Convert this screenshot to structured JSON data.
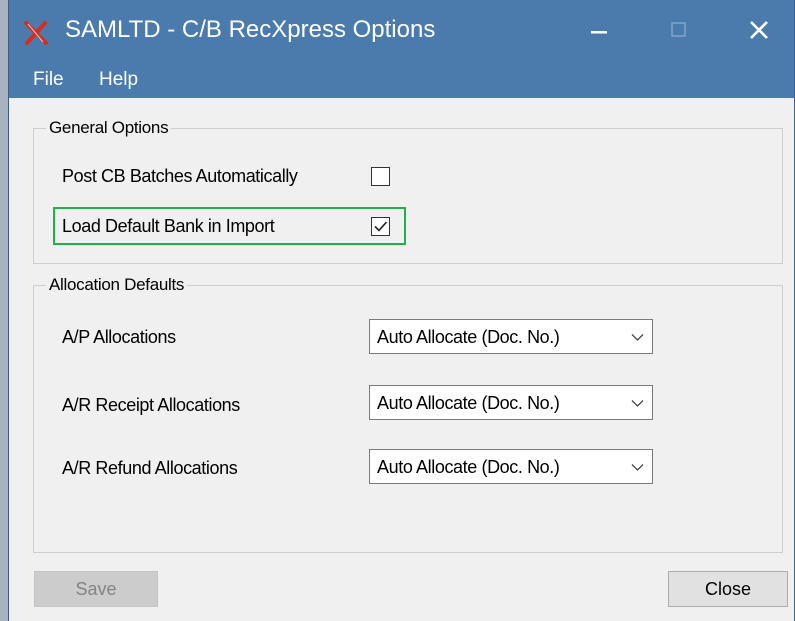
{
  "window": {
    "title": "SAMLTD - C/B RecXpress Options",
    "icon": "red-x-app-icon",
    "controls": [
      "minimize-icon",
      "maximize-icon",
      "close-icon"
    ]
  },
  "menu": {
    "file": "File",
    "help": "Help"
  },
  "general": {
    "legend": "General Options",
    "post_batches": {
      "label": "Post CB Batches Automatically",
      "checked": false
    },
    "load_bank": {
      "label": "Load Default Bank in Import",
      "checked": true
    }
  },
  "allocation": {
    "legend": "Allocation Defaults",
    "rows": [
      {
        "label": "A/P Allocations",
        "value": "Auto Allocate (Doc. No.)"
      },
      {
        "label": "A/R Receipt Allocations",
        "value": "Auto Allocate (Doc. No.)"
      },
      {
        "label": "A/R Refund Allocations",
        "value": "Auto Allocate (Doc. No.)"
      }
    ]
  },
  "buttons": {
    "save": "Save",
    "save_enabled": false,
    "close": "Close"
  },
  "colors": {
    "titlebar": "#4a7bac",
    "highlight": "#22b04b",
    "icon_red": "#d92b1e"
  }
}
